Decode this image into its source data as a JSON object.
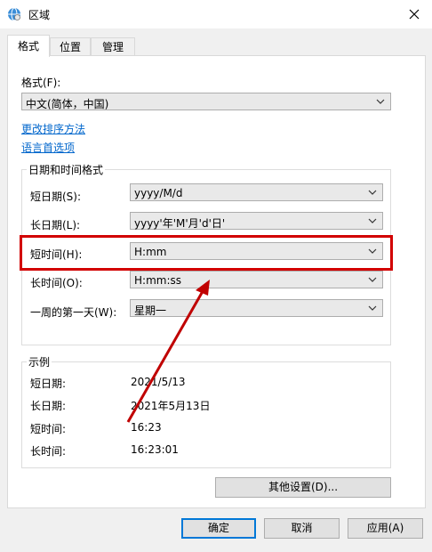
{
  "window": {
    "title": "区域",
    "close_icon": "close-icon",
    "globe_icon": "globe-icon"
  },
  "tabs": [
    {
      "label": "格式"
    },
    {
      "label": "位置"
    },
    {
      "label": "管理"
    }
  ],
  "format": {
    "label": "格式(F):",
    "value": "中文(简体，中国)",
    "link_sort": "更改排序方法",
    "link_lang": "语言首选项"
  },
  "datetime": {
    "group_title": "日期和时间格式",
    "rows": [
      {
        "label": "短日期(S):",
        "value": "yyyy/M/d"
      },
      {
        "label": "长日期(L):",
        "value": "yyyy'年'M'月'd'日'"
      },
      {
        "label": "短时间(H):",
        "value": "H:mm"
      },
      {
        "label": "长时间(O):",
        "value": "H:mm:ss"
      },
      {
        "label": "一周的第一天(W):",
        "value": "星期一"
      }
    ]
  },
  "examples": {
    "group_title": "示例",
    "rows": [
      {
        "label": "短日期:",
        "value": "2021/5/13"
      },
      {
        "label": "长日期:",
        "value": "2021年5月13日"
      },
      {
        "label": "短时间:",
        "value": "16:23"
      },
      {
        "label": "长时间:",
        "value": "16:23:01"
      }
    ]
  },
  "buttons": {
    "other_settings": "其他设置(D)...",
    "ok": "确定",
    "cancel": "取消",
    "apply": "应用(A)"
  },
  "annotation": {
    "highlight_color": "#d20000",
    "arrow_color": "#c00000"
  }
}
